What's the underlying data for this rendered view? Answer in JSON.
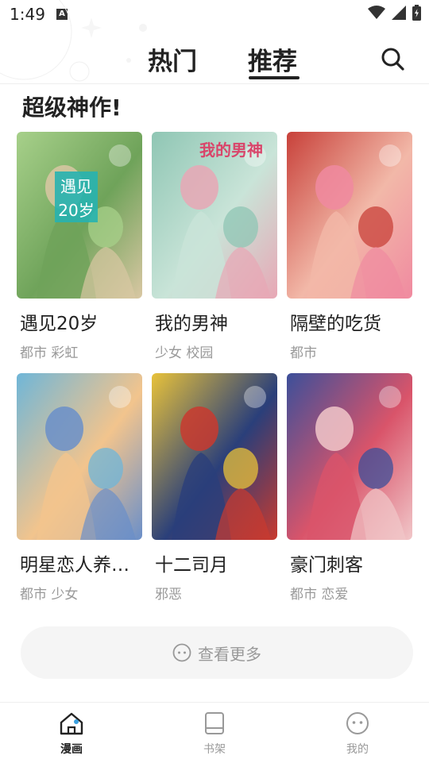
{
  "status_bar": {
    "time": "1:49",
    "notification_letter": "A"
  },
  "tabs": [
    {
      "label": "热门",
      "active": false
    },
    {
      "label": "推荐",
      "active": true
    }
  ],
  "section": {
    "title": "超级神作!"
  },
  "comics": [
    {
      "title": "遇见20岁",
      "tags": "都市 彩虹",
      "cover_text": [
        "遇见",
        "20岁"
      ],
      "colors": [
        "#a7d08a",
        "#6fa35a",
        "#d9c7a3"
      ]
    },
    {
      "title": "我的男神",
      "tags": "少女 校园",
      "cover_text": [
        "我的男神"
      ],
      "colors": [
        "#8fc6b4",
        "#c9e4d8",
        "#e8a7b5"
      ]
    },
    {
      "title": "隔壁的吃货",
      "tags": "都市",
      "cover_text": [],
      "colors": [
        "#c8413a",
        "#f2b8a8",
        "#f08aa0"
      ]
    },
    {
      "title": "明星恋人养…",
      "tags": "都市 少女",
      "cover_text": [],
      "colors": [
        "#6fb6d8",
        "#f2c48d",
        "#6a8fc9"
      ]
    },
    {
      "title": "十二司月",
      "tags": "邪恶",
      "cover_text": [],
      "colors": [
        "#e8c23a",
        "#2a3f7a",
        "#c93a2f"
      ]
    },
    {
      "title": "豪门刺客",
      "tags": "都市 恋爱",
      "cover_text": [],
      "colors": [
        "#3c4f9a",
        "#d9546a",
        "#f1c7c9"
      ]
    }
  ],
  "more_button": {
    "label": "查看更多"
  },
  "bottom_nav": [
    {
      "label": "漫画",
      "icon": "home-icon",
      "active": true
    },
    {
      "label": "书架",
      "icon": "bookshelf-icon",
      "active": false
    },
    {
      "label": "我的",
      "icon": "profile-icon",
      "active": false
    }
  ],
  "accent": "#222222"
}
